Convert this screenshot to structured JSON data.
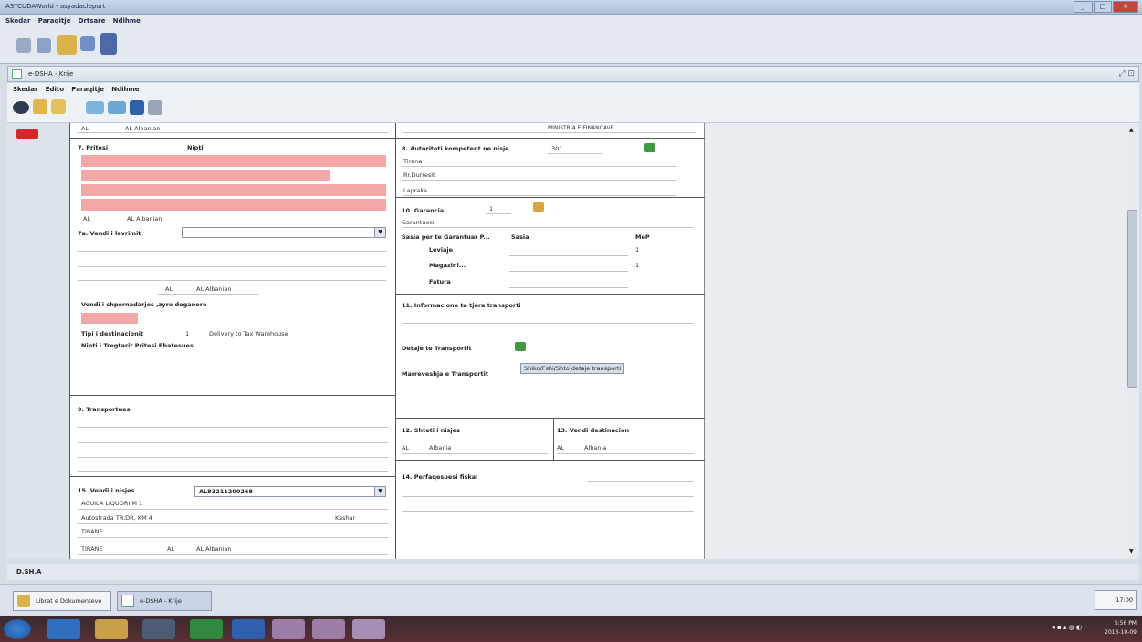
{
  "window": {
    "title": "ASYCUDAWorld - asyadacleport"
  },
  "top_menu": [
    "Skedar",
    "Paraqitje",
    "Drtsare",
    "Ndihme"
  ],
  "inner": {
    "title": "e-DSHA - Krije",
    "menu": [
      "Skedar",
      "Edito",
      "Paraqitje",
      "Ndihme"
    ]
  },
  "left": {
    "top_row": {
      "code": "AL",
      "name": "AL Albanian"
    },
    "box7": {
      "label": "7. Pritesi",
      "sub": "Nipti",
      "country": "AL",
      "country_name": "AL Albanian"
    },
    "box7a": {
      "label": "7a. Vendi i levrimit",
      "country": "AL",
      "country_name": "AL Albanian"
    },
    "location_label": "Vendi i shpernadarjes ,zyre doganore",
    "dest_type": {
      "label": "Tipi i destinacionit",
      "value": "1",
      "desc": "Delivery to Tax Warehouse"
    },
    "nipt_label": "Nipti i Tregtarit Pritesi Phatesues",
    "box9": {
      "label": "9. Transportuesi"
    },
    "box15": {
      "label": "15. Vendi i nisjes",
      "combo": "AL83211200268",
      "name": "AGUILA LIQUORI M 1",
      "address": "Autostrada TR.DR, KM 4",
      "city2": "Kashar",
      "city": "TIRANE",
      "city_b": "TIRANE",
      "country": "AL",
      "country_name": "AL Albanian"
    }
  },
  "right": {
    "top_value": "MINISTRIA E FINANCAVE",
    "box8": {
      "label": "8. Autoriteti kompetent ne nisje",
      "code": "301",
      "lines": [
        "Tirana",
        "Rr.Durresit",
        "Lapraka"
      ]
    },
    "box10": {
      "label": "10. Garancia",
      "value": "1",
      "sub": "Garantuesi",
      "table_header": [
        "Sasia per te Garantuar P...",
        "Sasia",
        "MeP"
      ],
      "rows": [
        {
          "name": "Leviaje",
          "mep": "1"
        },
        {
          "name": "Magazini...",
          "mep": "1"
        },
        {
          "name": "Fatura",
          "mep": ""
        }
      ]
    },
    "box11": {
      "label": "11. Informacione te tjera transporti",
      "details_label": "Detaje te Transportit",
      "org_label": "Marreveshja e Transportit",
      "edit_button": "Shiko/Fshi/Shto detaje transporti"
    },
    "box12": {
      "label": "12. Shteti i nisjes",
      "code": "AL",
      "name": "Albania"
    },
    "box13": {
      "label": "13. Vendi destinacion",
      "code": "AL",
      "name": "Albania"
    },
    "box14": {
      "label": "14. Perfaqesuesi fiskal"
    }
  },
  "status": {
    "text": "D.SH.A"
  },
  "subtasks": [
    {
      "label": "Librat e Dokumenteve"
    },
    {
      "label": "e-DSHA - Krije"
    }
  ],
  "taskbar": {
    "time": "5:56 PM",
    "date": "2013-10-09",
    "aux": "17:00"
  },
  "colors": {
    "required_field": "#f4a7a7",
    "accent": "#3d9a3d"
  }
}
